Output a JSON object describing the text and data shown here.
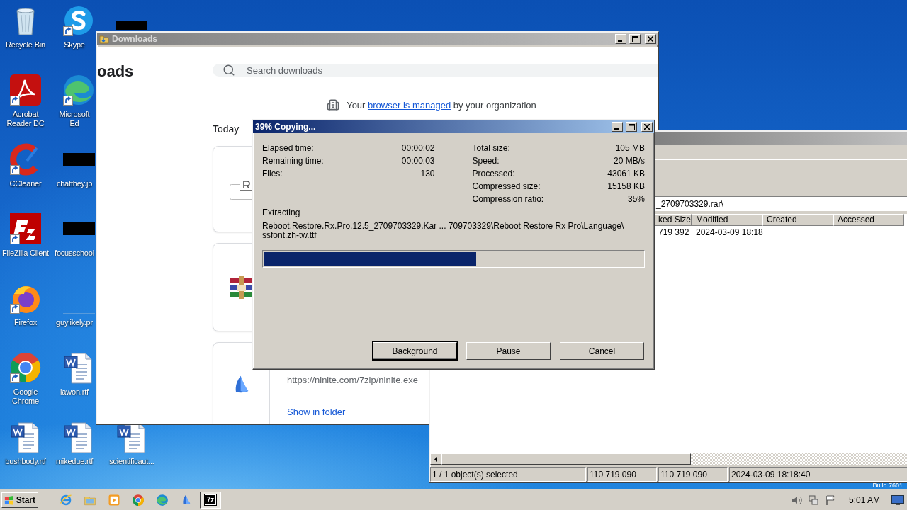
{
  "desktop": {
    "icon_columns": [
      [
        {
          "label": "Recycle Bin",
          "kind": "recycle",
          "shortcut": false
        },
        {
          "label": "Acrobat Reader DC",
          "kind": "acrobat",
          "shortcut": true
        },
        {
          "label": "CCleaner",
          "kind": "ccleaner",
          "shortcut": true
        },
        {
          "label": "FileZilla Client",
          "kind": "filezilla",
          "shortcut": true
        },
        {
          "label": "Firefox",
          "kind": "firefox",
          "shortcut": true
        },
        {
          "label": "Google Chrome",
          "kind": "chrome",
          "shortcut": true
        },
        {
          "label": "bushbody.rtf",
          "kind": "word",
          "shortcut": false
        }
      ],
      [
        {
          "label": "Skype",
          "kind": "skype",
          "shortcut": true
        },
        {
          "label": "Microsoft Ed",
          "kind": "edge",
          "shortcut": true
        },
        {
          "label": "chatthey.jp",
          "kind": "redacted",
          "shortcut": false
        },
        {
          "label": "focusschool",
          "kind": "redacted",
          "shortcut": false
        },
        {
          "label": "guylikely.pr",
          "kind": "blank",
          "shortcut": false
        },
        {
          "label": "lawon.rtf",
          "kind": "word",
          "shortcut": false
        },
        {
          "label": "mikedue.rtf",
          "kind": "word",
          "shortcut": false
        }
      ],
      [
        {
          "label": "scientificaut...",
          "kind": "word",
          "shortcut": false
        }
      ]
    ],
    "build_text": "Build 7601"
  },
  "downloads_window": {
    "title": "Downloads",
    "heading": "oads",
    "search": {
      "placeholder": "Search downloads"
    },
    "notice_before": "Your",
    "notice_link": "browser is managed",
    "notice_after": "by your organization",
    "section": "Today",
    "items": [
      {
        "kind": "file"
      },
      {
        "kind": "archive"
      },
      {
        "kind": "installer",
        "url": "https://ninite.com/7zip/ninite.exe",
        "action": "Show in folder"
      }
    ]
  },
  "archive_window": {
    "address": "_2709703329.rar\\",
    "columns": [
      "ked Size",
      "Modified",
      "Created",
      "Accessed"
    ],
    "rows": [
      [
        "719 392",
        "2024-03-09 18:18"
      ]
    ],
    "status": [
      "1 / 1 object(s) selected",
      "110 719 090",
      "110 719 090",
      "2024-03-09 18:18:40"
    ]
  },
  "dialog": {
    "title": "39% Copying...",
    "stats_left": [
      {
        "label": "Elapsed time:",
        "value": "00:00:02"
      },
      {
        "label": "Remaining time:",
        "value": "00:00:03"
      },
      {
        "label": "Files:",
        "value": "130"
      }
    ],
    "stats_right": [
      {
        "label": "Total size:",
        "value": "105 MB"
      },
      {
        "label": "Speed:",
        "value": "20 MB/s"
      },
      {
        "label": "Processed:",
        "value": "43061 KB"
      },
      {
        "label": "Compressed size:",
        "value": "15158 KB"
      },
      {
        "label": "Compression ratio:",
        "value": "35%"
      }
    ],
    "action": "Extracting",
    "path_lines": [
      "Reboot.Restore.Rx.Pro.12.5_2709703329.Kar ... 709703329\\Reboot Restore Rx Pro\\Language\\",
      "ssfont.zh-tw.ttf"
    ],
    "progress": {
      "level": 0.56
    },
    "buttons": [
      {
        "label": "Background",
        "default": true
      },
      {
        "label": "Pause",
        "default": false
      },
      {
        "label": "Cancel",
        "default": false
      }
    ]
  },
  "taskbar": {
    "start": "Start",
    "apps": [
      {
        "kind": "ie",
        "active": false
      },
      {
        "kind": "explorer",
        "active": false
      },
      {
        "kind": "media",
        "active": false
      },
      {
        "kind": "chrome",
        "active": false
      },
      {
        "kind": "edge",
        "active": false
      },
      {
        "kind": "ninite",
        "active": false
      },
      {
        "kind": "sevenzip",
        "label": "7z",
        "active": true
      }
    ],
    "clock": "5:01 AM"
  }
}
